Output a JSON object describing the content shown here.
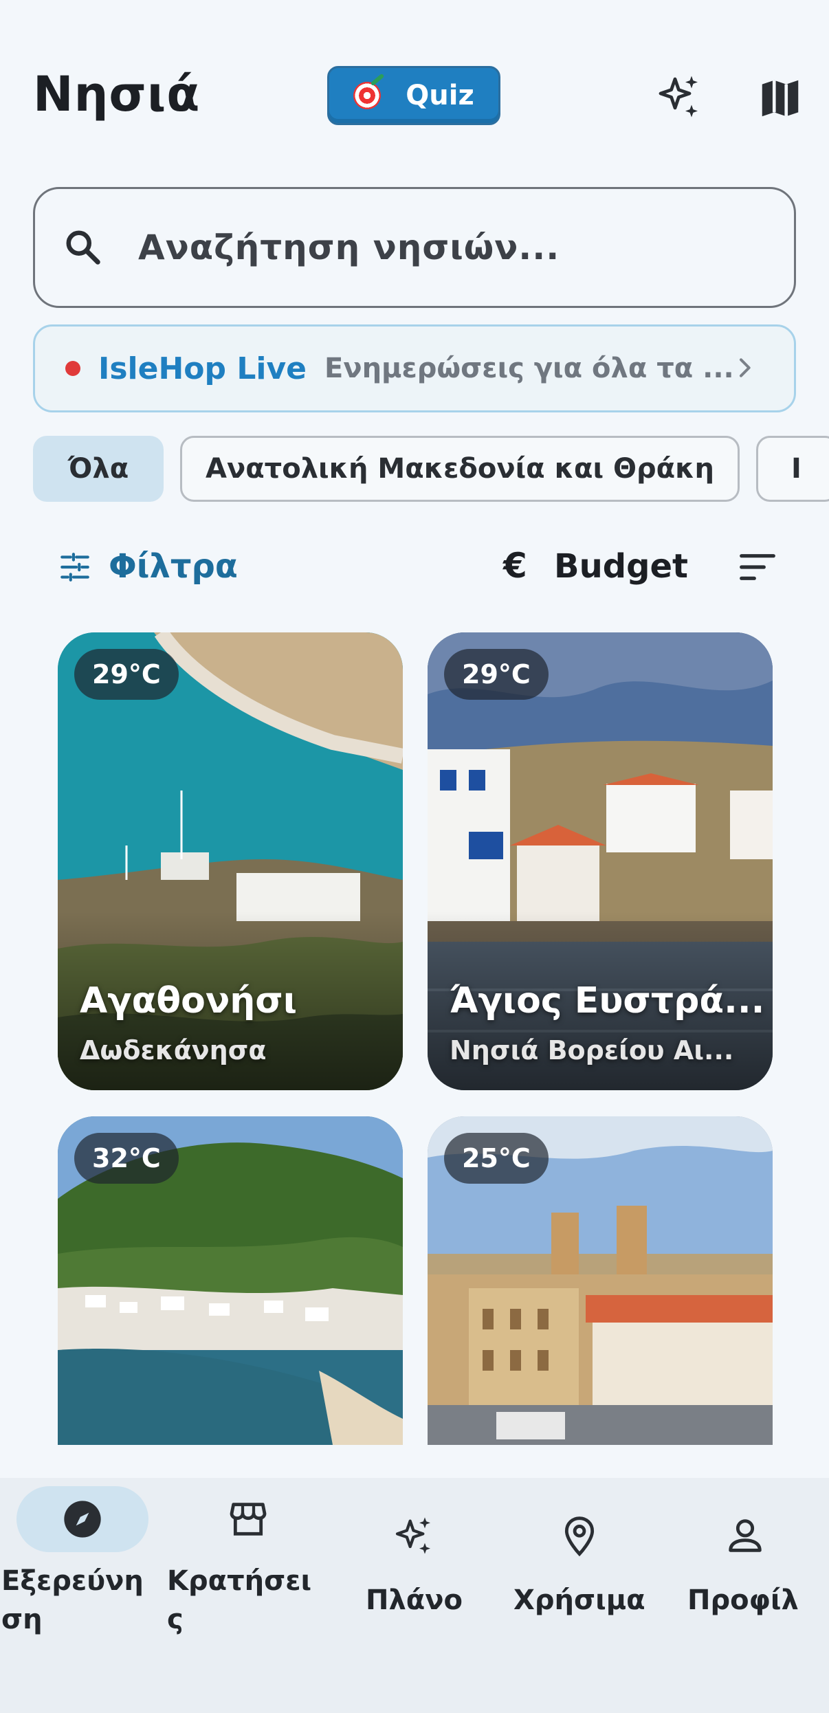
{
  "header": {
    "title": "Νησιά",
    "quiz_label": "Quiz",
    "quiz_icon": "target-icon",
    "sparkle_icon": "sparkle-icon",
    "map_icon": "map-icon"
  },
  "search": {
    "placeholder": "Αναζήτηση νησιών..."
  },
  "live": {
    "title": "IsleHop Live",
    "subtitle": "Ενημερώσεις για όλα τα ...",
    "dot_color": "#e03a3a"
  },
  "chips": [
    {
      "label": "Όλα",
      "selected": true
    },
    {
      "label": "Ανατολική Μακεδονία και Θράκη",
      "selected": false
    },
    {
      "label": "Ι",
      "selected": false
    }
  ],
  "filters": {
    "filters_label": "Φίλτρα",
    "euro_symbol": "€",
    "budget_label": "Budget"
  },
  "cards": [
    {
      "temp": "29°C",
      "name": "Αγαθονήσι",
      "region": "Δωδεκάνησα"
    },
    {
      "temp": "29°C",
      "name": "Άγιος Ευστρά...",
      "region": "Νησιά Βορείου Αι..."
    },
    {
      "temp": "32°C",
      "name": "",
      "region": ""
    },
    {
      "temp": "25°C",
      "name": "",
      "region": ""
    }
  ],
  "nav": [
    {
      "label": "Εξερεύνη\nση",
      "icon": "compass-icon",
      "active": true
    },
    {
      "label": "Κρατήσει\nς",
      "icon": "store-icon",
      "active": false
    },
    {
      "label": "Πλάνο",
      "icon": "sparkle-icon",
      "active": false
    },
    {
      "label": "Χρήσιμα",
      "icon": "location-pin-icon",
      "active": false
    },
    {
      "label": "Προφίλ",
      "icon": "person-icon",
      "active": false
    }
  ],
  "colors": {
    "accent": "#1f7fc1",
    "background": "#f3f7fb",
    "chip_selected": "#cfe3f0"
  }
}
